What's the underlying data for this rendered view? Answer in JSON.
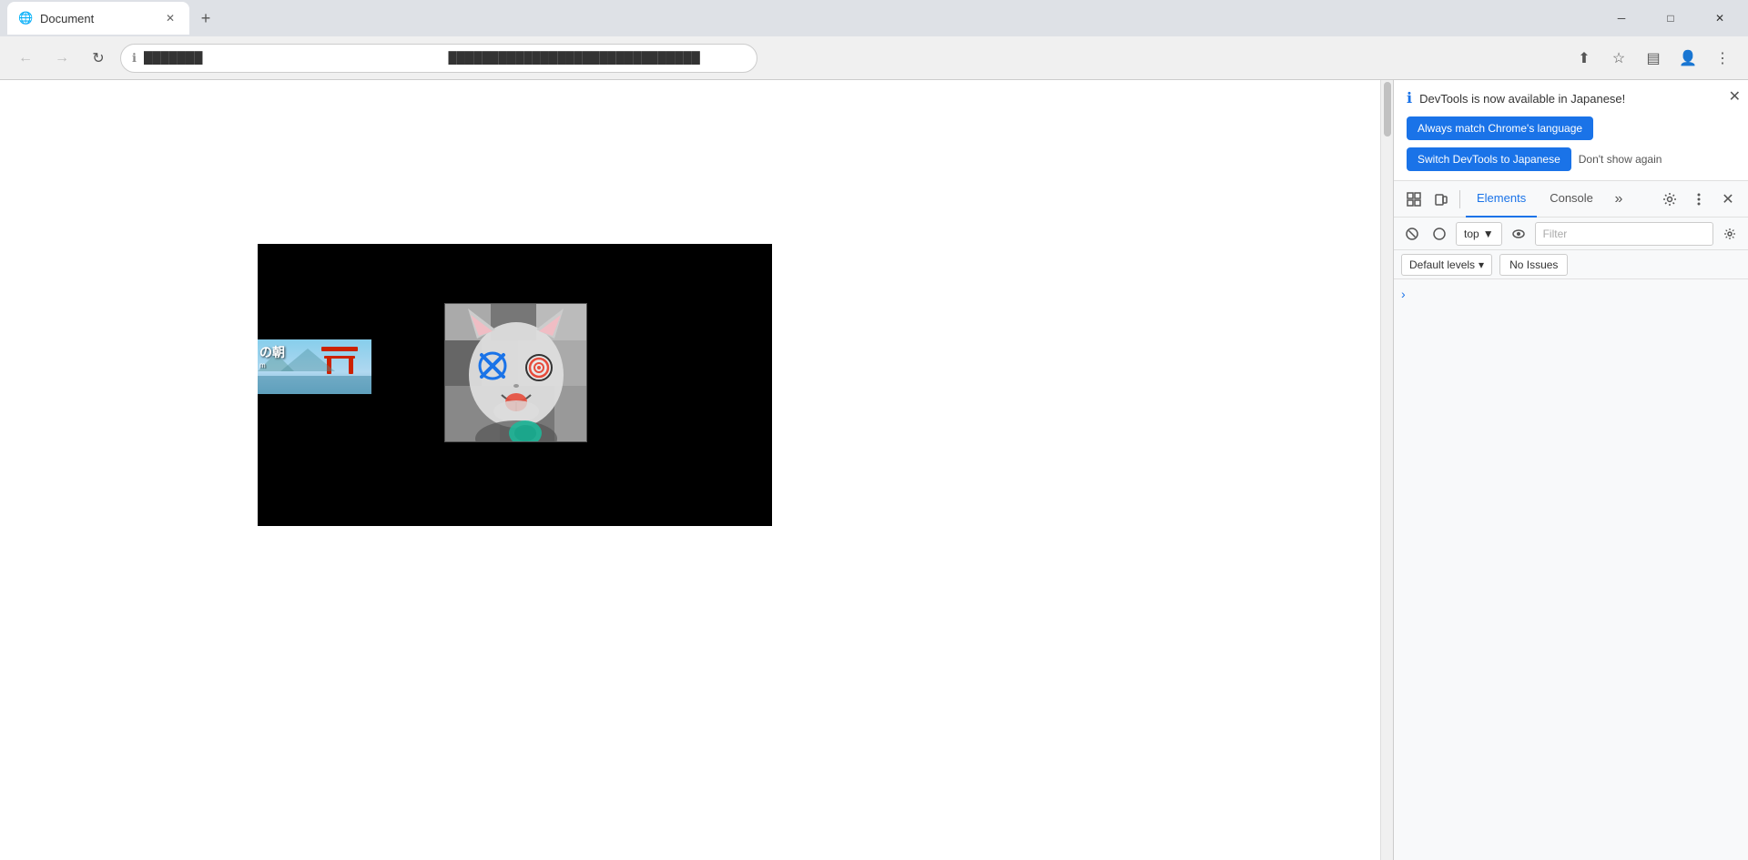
{
  "browser": {
    "tab_title": "Document",
    "tab_favicon": "🌐",
    "new_tab_icon": "+",
    "close_icon": "✕",
    "nav": {
      "back_label": "←",
      "forward_label": "→",
      "reload_label": "↻",
      "info_label": "ℹ",
      "url_part1": "███████",
      "url_part2": "██████████████████████████████",
      "bookmark_icon": "☆",
      "profile_icon": "👤",
      "menu_icon": "⋮",
      "sidebar_icon": "▤",
      "share_icon": "⬆"
    },
    "window_controls": {
      "minimize": "─",
      "maximize": "□",
      "close": "✕"
    }
  },
  "page": {
    "bg_color": "#ffffff",
    "canvas_bg": "#000000"
  },
  "devtools": {
    "notification": {
      "info_icon": "ℹ",
      "title": "DevTools is now available in Japanese!",
      "btn_always_match": "Always match Chrome's language",
      "btn_switch": "Switch DevTools to Japanese",
      "link_dont_show": "Don't show again",
      "close_icon": "✕"
    },
    "toolbar": {
      "element_picker_icon": "⬚",
      "device_toggle_icon": "⊡",
      "tab_elements": "Elements",
      "tab_console": "Console",
      "more_tabs_icon": "»",
      "settings_icon": "⚙",
      "more_options_icon": "⋮",
      "close_icon": "✕"
    },
    "console_bar": {
      "clear_icon": "🚫",
      "filter_icon": "◯",
      "context_label": "top",
      "context_arrow": "▼",
      "eye_icon": "👁",
      "filter_placeholder": "Filter",
      "settings_icon": "⚙"
    },
    "issues_bar": {
      "default_levels": "Default levels",
      "dropdown_icon": "▾",
      "no_issues": "No Issues"
    },
    "content": {
      "chevron": "›"
    }
  }
}
